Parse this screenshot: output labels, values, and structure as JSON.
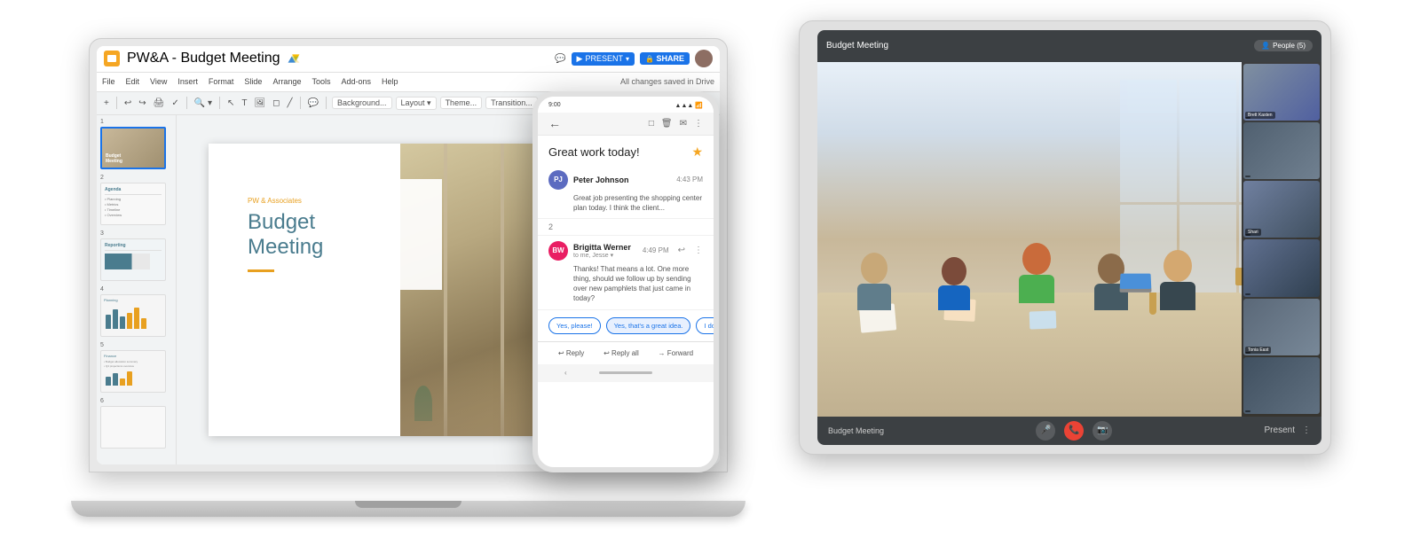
{
  "laptop": {
    "title": "PW&A - Budget Meeting",
    "menu": {
      "file": "File",
      "edit": "Edit",
      "view": "View",
      "insert": "Insert",
      "format": "Format",
      "slide": "Slide",
      "arrange": "Arrange",
      "tools": "Tools",
      "addons": "Add-ons",
      "help": "Help",
      "saved": "All changes saved in Drive"
    },
    "toolbar": {
      "background": "Background...",
      "layout": "Layout ▾",
      "theme": "Theme...",
      "transition": "Transition..."
    },
    "slide": {
      "company": "PW & Associates",
      "title_line1": "Budget",
      "title_line2": "Meeting"
    },
    "buttons": {
      "present": "PRESENT",
      "share": "SHARE"
    },
    "slide_numbers": [
      "1",
      "2",
      "3",
      "4",
      "5",
      "6"
    ]
  },
  "phone": {
    "status_time": "9:00",
    "subject": "Great work today!",
    "star": "★",
    "messages": [
      {
        "sender": "Peter Johnson",
        "avatar_initials": "PJ",
        "time": "4:43 PM",
        "body": "Great job presenting the shopping center plan today. I think the client..."
      },
      {
        "sender": "Brigitta Werner",
        "avatar_initials": "BW",
        "time": "4:49 PM",
        "to": "to me, Jesse ▾",
        "body": "Thanks! That means a lot. One more thing, should we follow up by sending over new pamphlets that just came in today?"
      }
    ],
    "thread_count": "2",
    "smart_replies": [
      "Yes, please!",
      "Yes, that's a great idea.",
      "I don't think so."
    ],
    "action_buttons": [
      "↩ Reply",
      "↩ Reply all",
      "→ Forward"
    ],
    "nav_icons": [
      "□",
      "🗑",
      "✉",
      "⋮"
    ]
  },
  "tablet": {
    "meeting_title": "Budget Meeting",
    "people_count": "People (5)",
    "controls": {
      "mic": "🎤",
      "camera": "📷",
      "end": "📞",
      "present": "Present",
      "more": "⋮"
    },
    "participants": [
      {
        "label": "Brett Kasten"
      },
      {
        "label": ""
      },
      {
        "label": "Shari"
      },
      {
        "label": ""
      },
      {
        "label": "Tonia East"
      },
      {
        "label": ""
      }
    ]
  },
  "colors": {
    "google_blue": "#1a73e8",
    "google_yellow": "#F5A623",
    "slide_teal": "#4a7c8e",
    "meet_dark": "#3c4043"
  }
}
